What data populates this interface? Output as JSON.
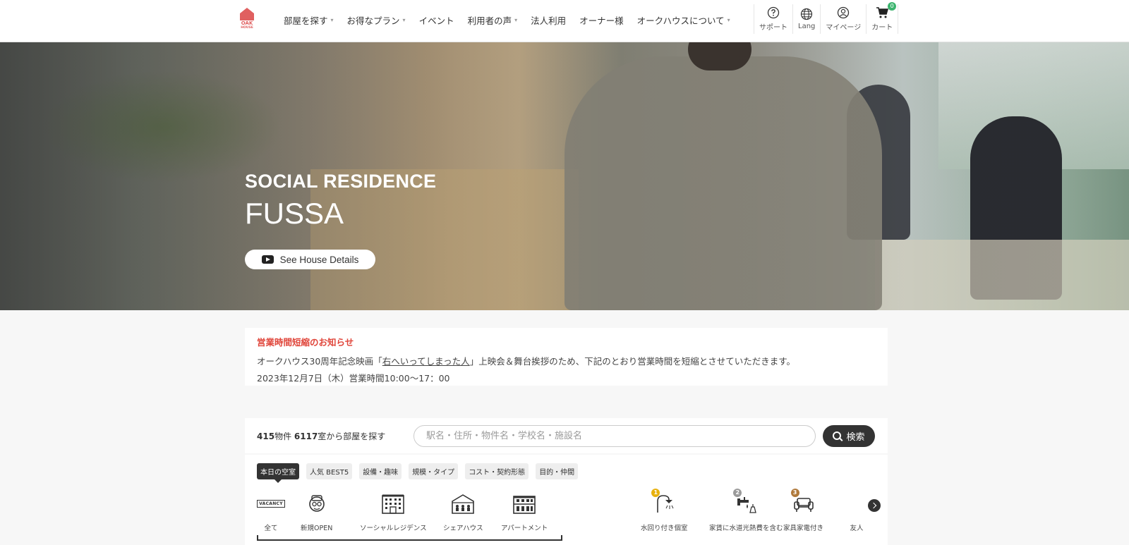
{
  "brand": {
    "logo_main": "OAK",
    "logo_sub": "HOUSE",
    "accent": "#e06060"
  },
  "nav": {
    "items": [
      {
        "label": "部屋を探す",
        "dropdown": true
      },
      {
        "label": "お得なプラン",
        "dropdown": true
      },
      {
        "label": "イベント",
        "dropdown": false
      },
      {
        "label": "利用者の声",
        "dropdown": true
      },
      {
        "label": "法人利用",
        "dropdown": false
      },
      {
        "label": "オーナー様",
        "dropdown": false
      },
      {
        "label": "オークハウスについて",
        "dropdown": true
      }
    ]
  },
  "util": {
    "support": "サポート",
    "lang": "Lang",
    "mypage": "マイページ",
    "cart": "カート",
    "cart_count": "0"
  },
  "hero": {
    "subtitle": "SOCIAL RESIDENCE",
    "title": "FUSSA",
    "button": "See House Details"
  },
  "notice": {
    "title": "営業時間短縮のお知らせ",
    "line1_pre": "オークハウス30周年記念映画「",
    "line1_link": "右へいってしまった人",
    "line1_post": "」上映会＆舞台挨拶のため、下記のとおり営業時間を短縮とさせていただきます。",
    "line2": "2023年12月7日（木）営業時間10:00〜17：00",
    "title_color": "#e0463b"
  },
  "search": {
    "properties": "415",
    "properties_unit": "物件 ",
    "rooms": "6117",
    "rooms_suffix": "室から部屋を探す",
    "placeholder": "駅名・住所・物件名・学校名・施設名",
    "button": "検索"
  },
  "tabs": [
    {
      "label": "本日の空室",
      "active": true
    },
    {
      "label": "人気 BEST5",
      "active": false
    },
    {
      "label": "設備・趣味",
      "active": false
    },
    {
      "label": "規模・タイプ",
      "active": false
    },
    {
      "label": "コスト・契約形態",
      "active": false
    },
    {
      "label": "目的・仲間",
      "active": false
    }
  ],
  "categories": {
    "vacancy_text": "VACANCY",
    "items": [
      {
        "label": "全て",
        "icon": "vacancy-icon"
      },
      {
        "label": "新規OPEN",
        "icon": "new-open-icon"
      },
      {
        "label": "ソーシャルレジデンス",
        "icon": "building-icon"
      },
      {
        "label": "シェアハウス",
        "icon": "share-house-icon"
      },
      {
        "label": "アパートメント",
        "icon": "apartment-icon"
      }
    ],
    "best": [
      {
        "label": "水回り付き個室",
        "rank": "1",
        "icon": "shower-icon",
        "rank_color": "#e8b10d"
      },
      {
        "label": "家賃に水道光熱費を含む",
        "rank": "2",
        "icon": "utilities-icon",
        "rank_color": "#9a9a9a"
      },
      {
        "label": "家具家電付き",
        "rank": "3",
        "icon": "sofa-icon",
        "rank_color": "#b07a3c"
      },
      {
        "label": "友人",
        "rank": "",
        "icon": "friends-icon",
        "rank_color": ""
      }
    ]
  }
}
